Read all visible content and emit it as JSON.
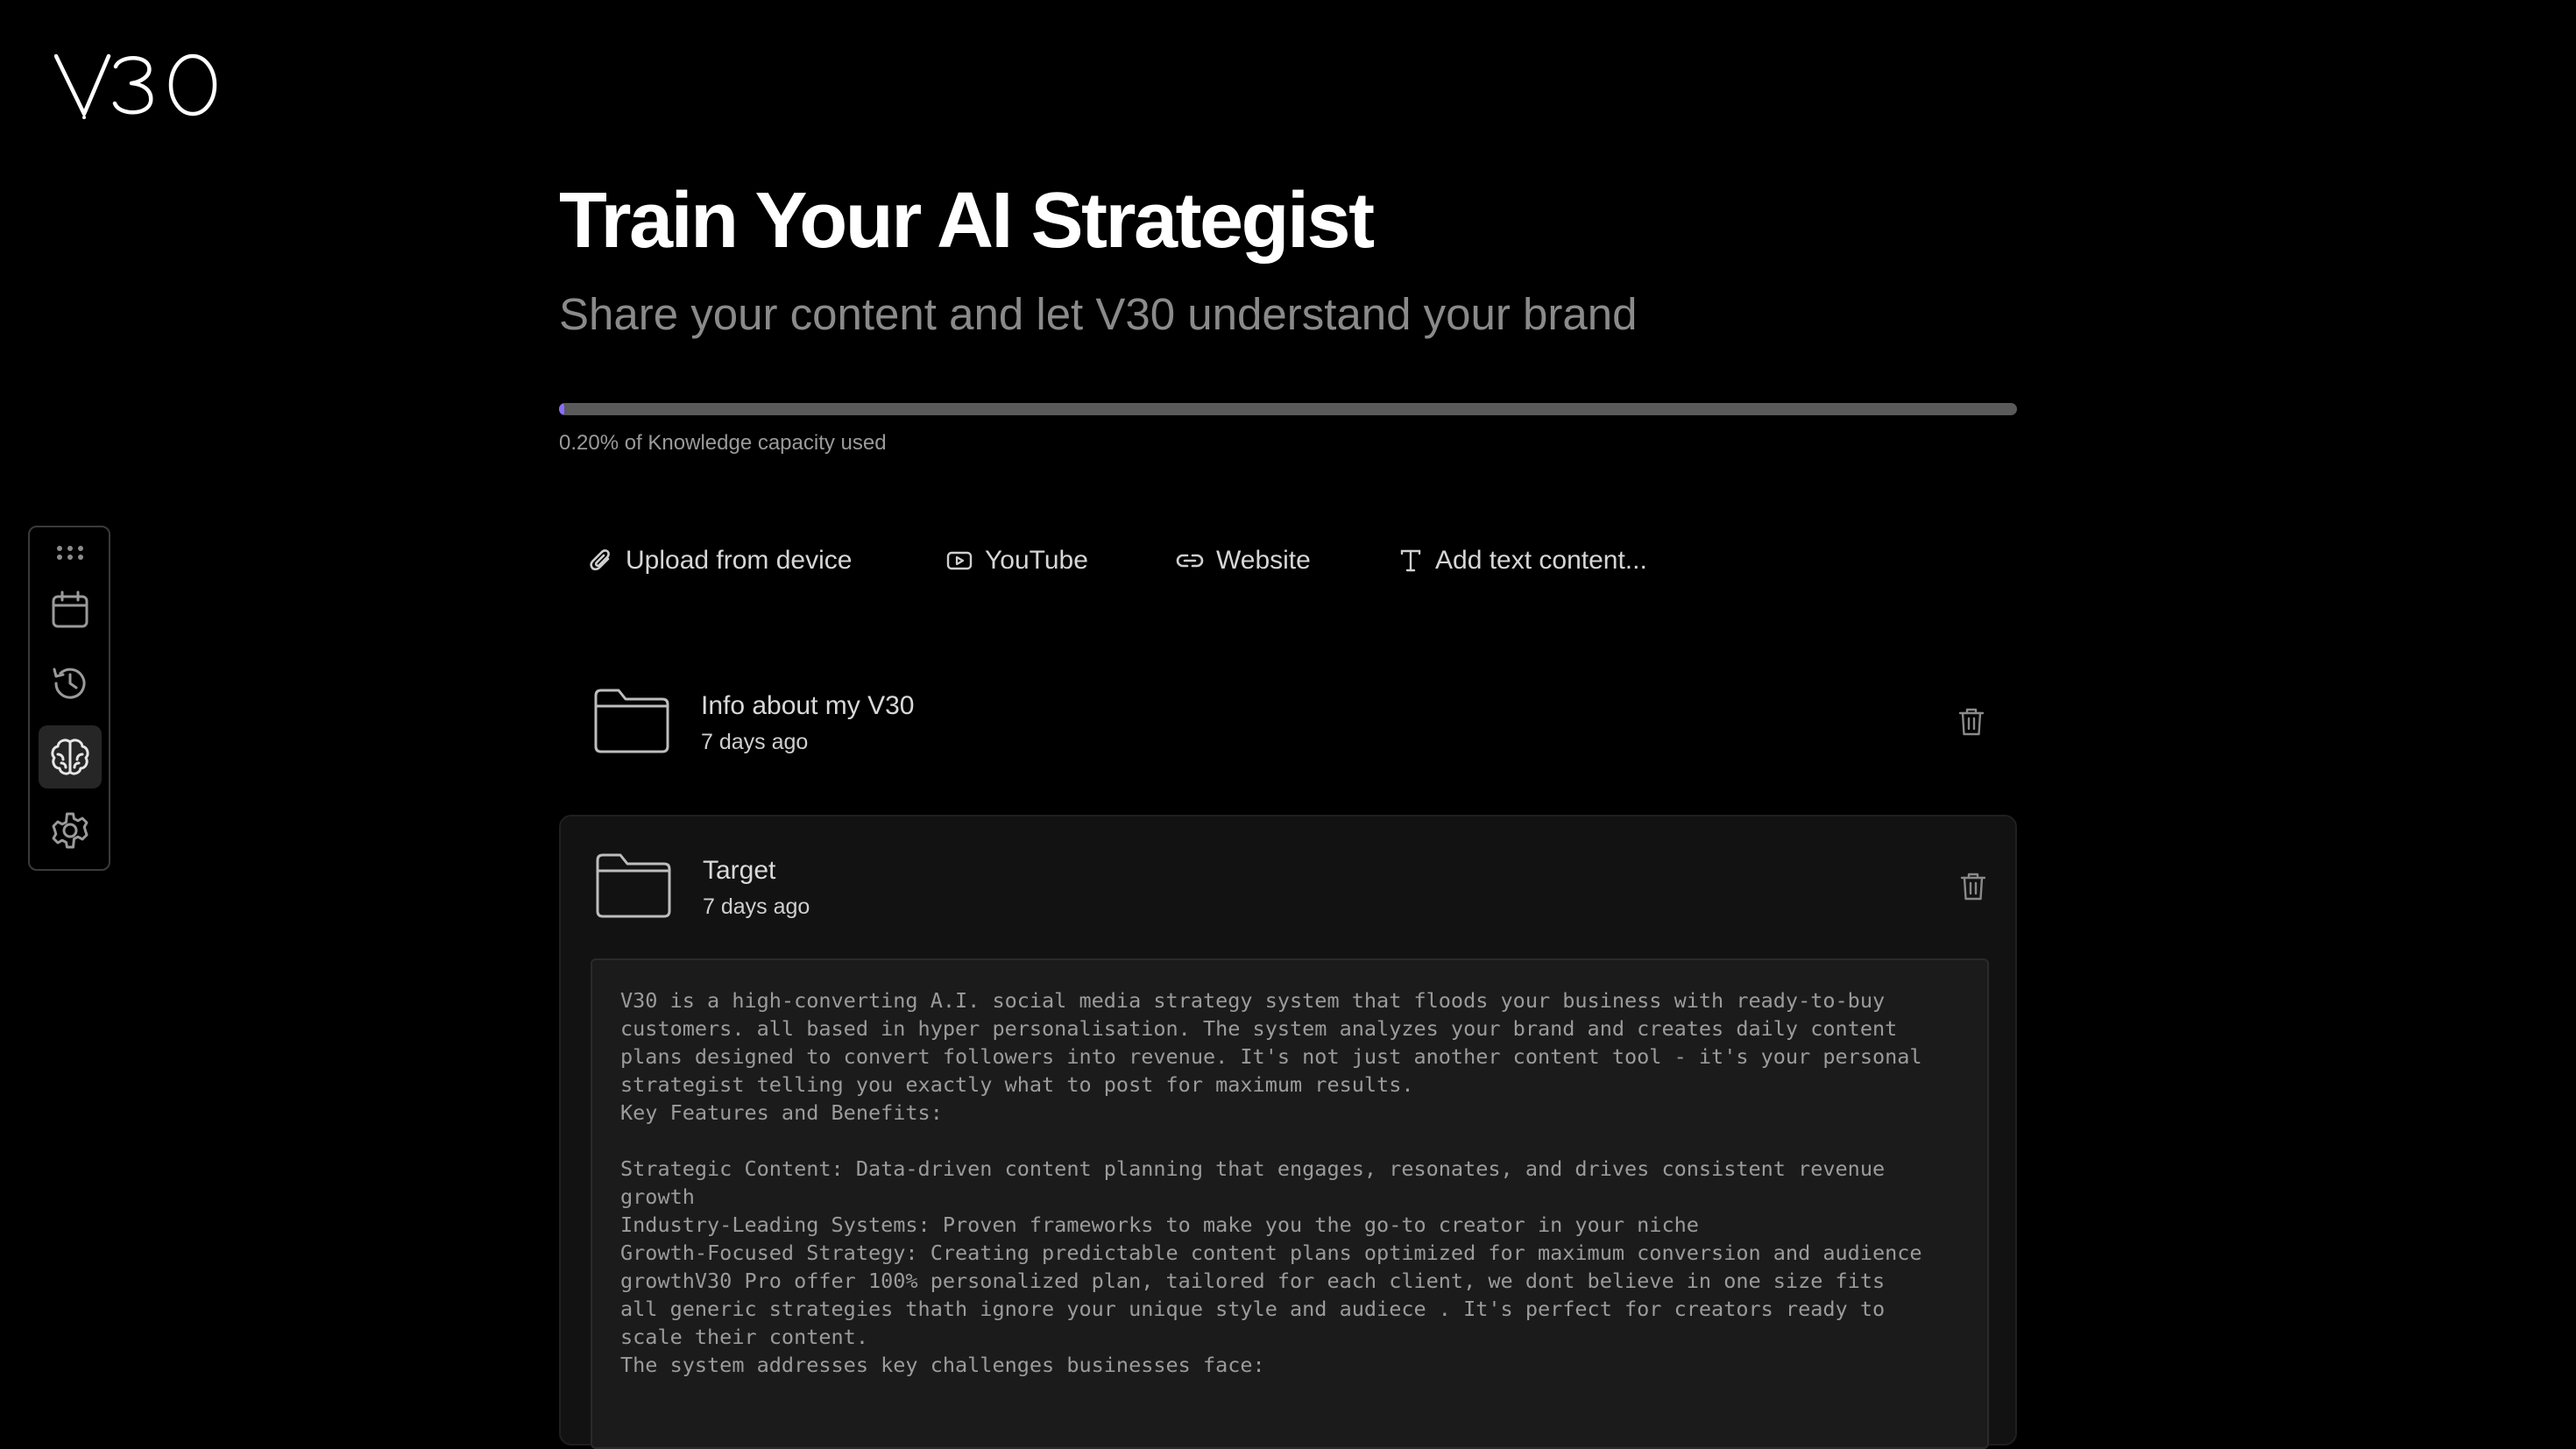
{
  "brand": {
    "logo_text": "V30"
  },
  "rail": {
    "items": [
      {
        "icon": "calendar-icon",
        "active": false
      },
      {
        "icon": "history-icon",
        "active": false
      },
      {
        "icon": "brain-icon",
        "active": true
      },
      {
        "icon": "settings-icon",
        "active": false
      }
    ]
  },
  "header": {
    "title": "Train Your AI Strategist",
    "subtitle": "Share your content and let V30 understand your brand"
  },
  "knowledge": {
    "used_percent": 0.2,
    "label": "0.20% of Knowledge capacity used",
    "bar_color": "#5a5a5a",
    "fill_color": "#8b6cff"
  },
  "sources": {
    "upload_label": "Upload from device",
    "youtube_label": "YouTube",
    "website_label": "Website",
    "text_label": "Add text content..."
  },
  "folders": [
    {
      "name": "Info about my V30",
      "date": "7 days ago"
    },
    {
      "name": "Target",
      "date": "7 days ago"
    }
  ],
  "expanded_content": "V30 is a high-converting A.I. social media strategy system that floods your business with ready-to-buy\ncustomers. all based in hyper personalisation. The system analyzes your brand and creates daily content\nplans designed to convert followers into revenue. It's not just another content tool - it's your personal\nstrategist telling you exactly what to post for maximum results.\nKey Features and Benefits:\n\nStrategic Content: Data-driven content planning that engages, resonates, and drives consistent revenue\ngrowth\nIndustry-Leading Systems: Proven frameworks to make you the go-to creator in your niche\nGrowth-Focused Strategy: Creating predictable content plans optimized for maximum conversion and audience\ngrowthV30 Pro offer 100% personalized plan, tailored for each client, we dont believe in one size fits\nall generic strategies thath ignore your unique style and audiece . It's perfect for creators ready to\nscale their content.\nThe system addresses key challenges businesses face:"
}
